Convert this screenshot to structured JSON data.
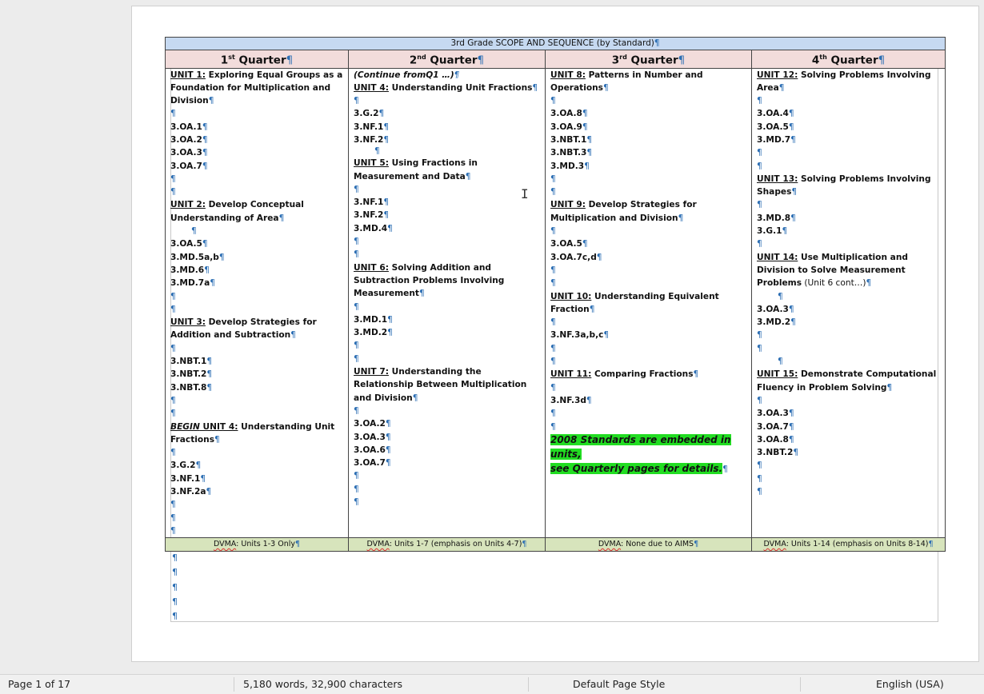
{
  "document": {
    "table_title": "3rd Grade SCOPE AND SEQUENCE (by Standard)",
    "pilcrow": "¶",
    "quarters": [
      {
        "num": "1",
        "sup": "st",
        "label": "Quarter"
      },
      {
        "num": "2",
        "sup": "nd",
        "label": "Quarter"
      },
      {
        "num": "3",
        "sup": "rd",
        "label": "Quarter"
      },
      {
        "num": "4",
        "sup": "th",
        "label": "Quarter"
      }
    ],
    "footers": [
      {
        "prefix": "DVMA",
        "text": ": Units 1-3 Only"
      },
      {
        "prefix": "DVMA",
        "text": ": Units 1-7 (emphasis on Units 4-7)"
      },
      {
        "prefix": "DVMA",
        "text": ": None due to AIMS"
      },
      {
        "prefix": "DVMA",
        "text": ": Units 1-14 (emphasis on Units 8-14)"
      }
    ],
    "col1": {
      "u1_label": "UNIT 1:",
      "u1_title": " Exploring Equal Groups as a Foundation for Multiplication and Division",
      "u1_std": [
        "3.OA.1",
        "3.OA.2",
        "3.OA.3",
        "3.OA.7"
      ],
      "u2_label": "UNIT 2:",
      "u2_title": " Develop Conceptual Understanding of Area",
      "u2_std": [
        "3.OA.5",
        "3.MD.5a,b",
        "3.MD.6",
        "3.MD.7a"
      ],
      "u3_label": "UNIT 3:",
      "u3_title": " Develop Strategies for Addition and Subtraction",
      "u3_std": [
        "3.NBT.1",
        "3.NBT.2",
        "3.NBT.8"
      ],
      "u4_begin": "BEGIN",
      "u4_label": " UNIT 4:",
      "u4_title": " Understanding Unit Fractions",
      "u4_std": [
        "3.G.2",
        "3.NF.1",
        "3.NF.2a"
      ]
    },
    "col2": {
      "continue": "(Continue fromQ1 …)",
      "u4_label": "UNIT 4:",
      "u4_title": " Understanding Unit Fractions",
      "u4_std": [
        "3.G.2",
        "3.NF.1",
        "3.NF.2"
      ],
      "u5_label": "UNIT 5:",
      "u5_title": " Using Fractions in Measurement and Data",
      "u5_std": [
        "3.NF.1",
        "3.NF.2",
        "3.MD.4"
      ],
      "u6_label": "UNIT 6:",
      "u6_title": " Solving Addition and Subtraction Problems Involving Measurement",
      "u6_std": [
        "3.MD.1",
        "3.MD.2"
      ],
      "u7_label": "UNIT 7:",
      "u7_title": " Understanding the Relationship Between Multiplication and Division",
      "u7_std": [
        "3.OA.2",
        "3.OA.3",
        "3.OA.6",
        "3.OA.7"
      ]
    },
    "col3": {
      "u8_label": "UNIT 8:",
      "u8_title": " Patterns in Number and Operations",
      "u8_std": [
        "3.OA.8",
        "3.OA.9",
        "3.NBT.1",
        "3.NBT.3",
        "3.MD.3"
      ],
      "u9_label": "UNIT 9:",
      "u9_title": " Develop Strategies for Multiplication and Division",
      "u9_std": [
        "3.OA.5",
        "3.OA.7c,d"
      ],
      "u10_label": "UNIT 10:",
      "u10_title": " Understanding Equivalent Fraction",
      "u10_std": [
        "3.NF.3a,b,c"
      ],
      "u11_label": "UNIT 11:",
      "u11_title": " Comparing Fractions",
      "u11_std": [
        "3.NF.3d"
      ],
      "note_line1": "2008 Standards are embedded in units,",
      "note_line2": "see Quarterly pages for details."
    },
    "col4": {
      "u12_label": "UNIT 12:",
      "u12_title": " Solving Problems Involving Area",
      "u12_std": [
        "3.OA.4",
        "3.OA.5",
        "3.MD.7"
      ],
      "u13_label": "UNIT 13:",
      "u13_title": " Solving Problems Involving Shapes",
      "u13_std": [
        "3.MD.8",
        "3.G.1"
      ],
      "u14_label": "UNIT 14:",
      "u14_title": " Use Multiplication and Division to Solve Measurement Problems",
      "u14_note": " (Unit 6 cont…)",
      "u14_std": [
        "3.OA.3",
        "3.MD.2"
      ],
      "u15_label": "UNIT 15:",
      "u15_title": " Demonstrate Computational Fluency in Problem Solving",
      "u15_std": [
        "3.OA.3",
        "3.OA.7",
        "3.OA.8",
        "3.NBT.2"
      ]
    }
  },
  "statusbar": {
    "page": "Page 1 of 17",
    "words": "5,180 words, 32,900 characters",
    "page_style": "Default Page Style",
    "language": "English (USA)"
  }
}
